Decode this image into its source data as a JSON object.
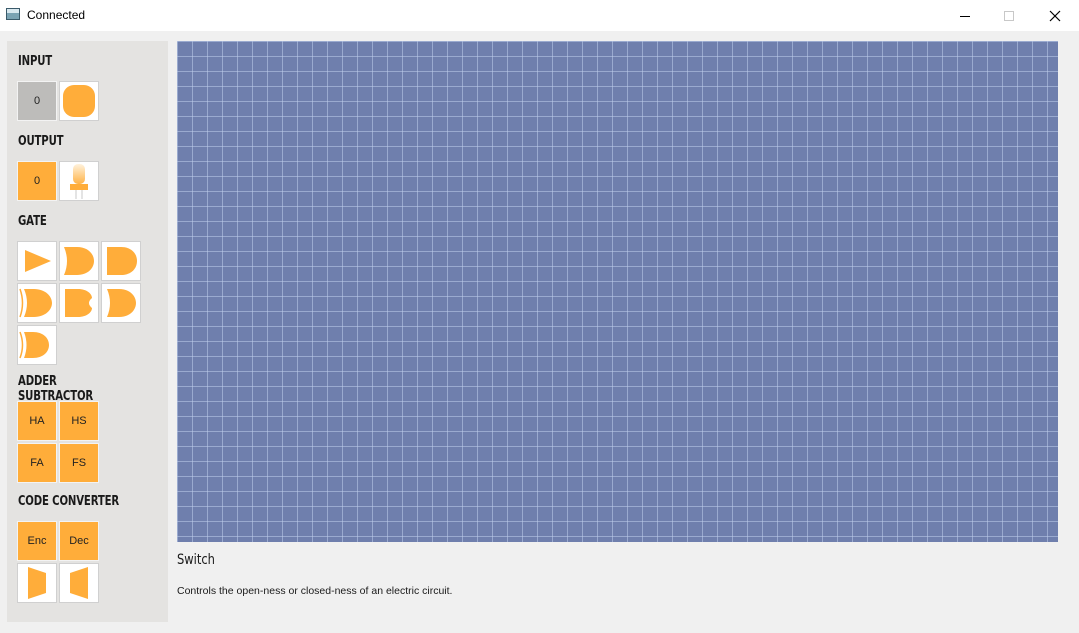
{
  "window": {
    "title": "Connected",
    "controls": [
      "minimize-icon",
      "maximize-icon",
      "close-icon"
    ]
  },
  "accent_color": "#ffad3a",
  "canvas_color": "#6f7fad",
  "sidebar": {
    "input": {
      "label": "INPUT",
      "items": [
        {
          "text": "0",
          "style": "grey"
        },
        {
          "icon": "switch-icon"
        }
      ]
    },
    "output": {
      "label": "OUTPUT",
      "items": [
        {
          "text": "0",
          "style": "orange"
        },
        {
          "icon": "led-icon"
        }
      ]
    },
    "gate": {
      "label": "GATE",
      "items": [
        "buffer-gate-icon",
        "and-gate-icon",
        "nand-gate-icon",
        "or-gate-icon",
        "nor-gate-icon",
        "xor-gate-icon",
        "xnor-gate-icon"
      ]
    },
    "adder_subtractor": {
      "label": "ADDER SUBTRACTOR",
      "items": [
        "HA",
        "HS",
        "FA",
        "FS"
      ]
    },
    "code_converter": {
      "label": "CODE CONVERTER",
      "items": [
        "Enc",
        "Dec"
      ],
      "icons": [
        "multiplexer-icon",
        "demultiplexer-icon"
      ]
    }
  },
  "info": {
    "title": "Switch",
    "description": "Controls the open-ness or closed-ness of an electric circuit."
  }
}
